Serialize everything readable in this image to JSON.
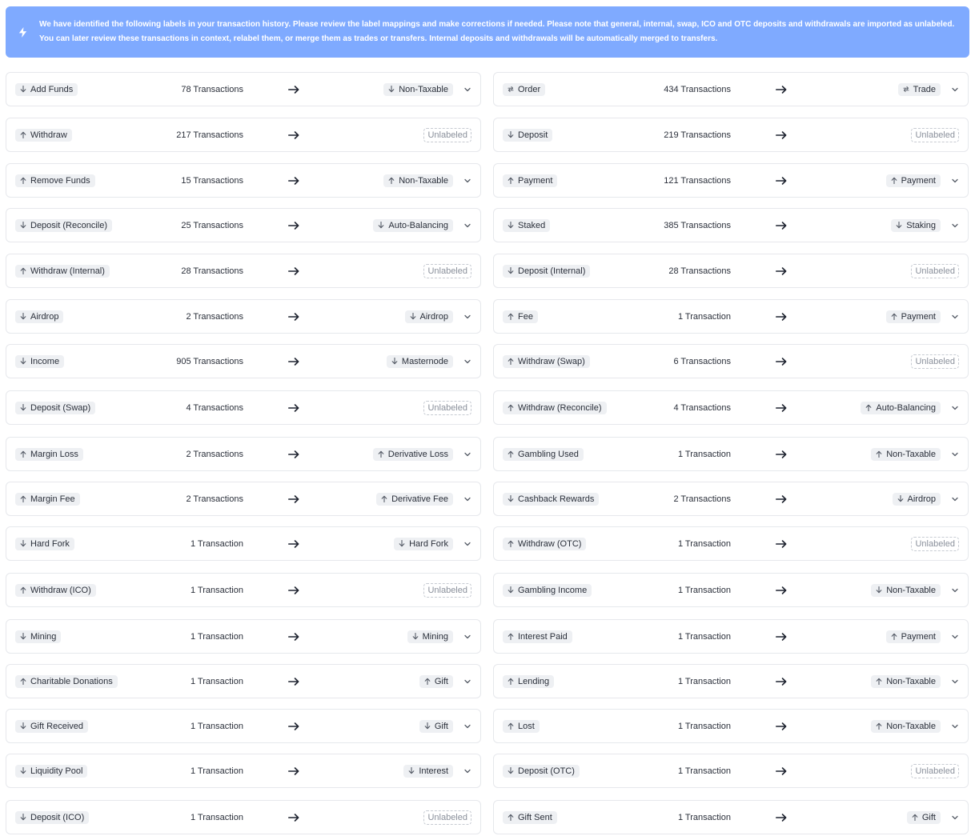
{
  "banner": {
    "icon": "lightning-bolt-icon",
    "text": "We have identified the following labels in your transaction history. Please review the label mappings and make corrections if needed. Please note that general, internal, swap, ICO and OTC deposits and withdrawals are imported as unlabeled. You can later review these transactions in context, relabel them, or merge them as trades or transfers. Internal deposits and withdrawals will be automatically merged to transfers."
  },
  "unlabeled_text": "Unlabeled",
  "left": [
    {
      "label": "Add Funds",
      "dir": "in",
      "count": "78 Transactions",
      "target": "Non-Taxable",
      "tdir": "in"
    },
    {
      "label": "Withdraw",
      "dir": "out",
      "count": "217 Transactions",
      "target": null
    },
    {
      "label": "Remove Funds",
      "dir": "out",
      "count": "15 Transactions",
      "target": "Non-Taxable",
      "tdir": "out"
    },
    {
      "label": "Deposit (Reconcile)",
      "dir": "in",
      "count": "25 Transactions",
      "target": "Auto-Balancing",
      "tdir": "in"
    },
    {
      "label": "Withdraw (Internal)",
      "dir": "out",
      "count": "28 Transactions",
      "target": null
    },
    {
      "label": "Airdrop",
      "dir": "in",
      "count": "2 Transactions",
      "target": "Airdrop",
      "tdir": "in"
    },
    {
      "label": "Income",
      "dir": "in",
      "count": "905 Transactions",
      "target": "Masternode",
      "tdir": "in"
    },
    {
      "label": "Deposit (Swap)",
      "dir": "in",
      "count": "4 Transactions",
      "target": null
    },
    {
      "label": "Margin Loss",
      "dir": "out",
      "count": "2 Transactions",
      "target": "Derivative Loss",
      "tdir": "out"
    },
    {
      "label": "Margin Fee",
      "dir": "out",
      "count": "2 Transactions",
      "target": "Derivative Fee",
      "tdir": "out"
    },
    {
      "label": "Hard Fork",
      "dir": "in",
      "count": "1 Transaction",
      "target": "Hard Fork",
      "tdir": "in"
    },
    {
      "label": "Withdraw (ICO)",
      "dir": "out",
      "count": "1 Transaction",
      "target": null
    },
    {
      "label": "Mining",
      "dir": "in",
      "count": "1 Transaction",
      "target": "Mining",
      "tdir": "in"
    },
    {
      "label": "Charitable Donations",
      "dir": "out",
      "count": "1 Transaction",
      "target": "Gift",
      "tdir": "out"
    },
    {
      "label": "Gift Received",
      "dir": "in",
      "count": "1 Transaction",
      "target": "Gift",
      "tdir": "in"
    },
    {
      "label": "Liquidity Pool",
      "dir": "in",
      "count": "1 Transaction",
      "target": "Interest",
      "tdir": "in"
    },
    {
      "label": "Deposit (ICO)",
      "dir": "in",
      "count": "1 Transaction",
      "target": null
    }
  ],
  "right": [
    {
      "label": "Order",
      "dir": "swap",
      "count": "434 Transactions",
      "target": "Trade",
      "tdir": "swap"
    },
    {
      "label": "Deposit",
      "dir": "in",
      "count": "219 Transactions",
      "target": null
    },
    {
      "label": "Payment",
      "dir": "out",
      "count": "121 Transactions",
      "target": "Payment",
      "tdir": "out"
    },
    {
      "label": "Staked",
      "dir": "in",
      "count": "385 Transactions",
      "target": "Staking",
      "tdir": "in"
    },
    {
      "label": "Deposit (Internal)",
      "dir": "in",
      "count": "28 Transactions",
      "target": null
    },
    {
      "label": "Fee",
      "dir": "out",
      "count": "1 Transaction",
      "target": "Payment",
      "tdir": "out"
    },
    {
      "label": "Withdraw (Swap)",
      "dir": "out",
      "count": "6 Transactions",
      "target": null
    },
    {
      "label": "Withdraw (Reconcile)",
      "dir": "out",
      "count": "4 Transactions",
      "target": "Auto-Balancing",
      "tdir": "out"
    },
    {
      "label": "Gambling Used",
      "dir": "out",
      "count": "1 Transaction",
      "target": "Non-Taxable",
      "tdir": "out"
    },
    {
      "label": "Cashback Rewards",
      "dir": "in",
      "count": "2 Transactions",
      "target": "Airdrop",
      "tdir": "in"
    },
    {
      "label": "Withdraw (OTC)",
      "dir": "out",
      "count": "1 Transaction",
      "target": null
    },
    {
      "label": "Gambling Income",
      "dir": "in",
      "count": "1 Transaction",
      "target": "Non-Taxable",
      "tdir": "in"
    },
    {
      "label": "Interest Paid",
      "dir": "out",
      "count": "1 Transaction",
      "target": "Payment",
      "tdir": "out"
    },
    {
      "label": "Lending",
      "dir": "out",
      "count": "1 Transaction",
      "target": "Non-Taxable",
      "tdir": "out"
    },
    {
      "label": "Lost",
      "dir": "out",
      "count": "1 Transaction",
      "target": "Non-Taxable",
      "tdir": "out"
    },
    {
      "label": "Deposit (OTC)",
      "dir": "in",
      "count": "1 Transaction",
      "target": null
    },
    {
      "label": "Gift Sent",
      "dir": "out",
      "count": "1 Transaction",
      "target": "Gift",
      "tdir": "out"
    }
  ]
}
